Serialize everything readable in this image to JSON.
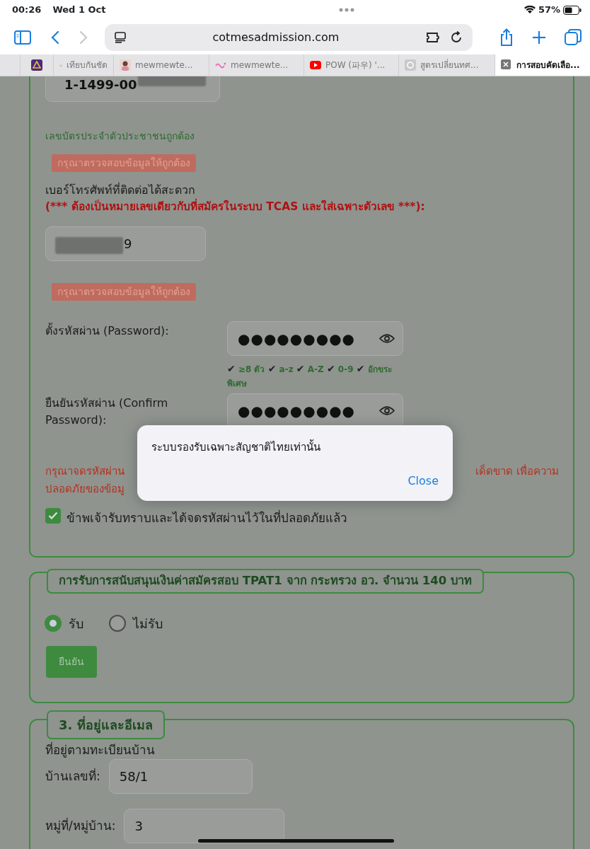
{
  "status_bar": {
    "time": "00:26",
    "date": "Wed 1 Oct",
    "battery": "57%"
  },
  "browser": {
    "url": "cotmesadmission.com",
    "forward_disabled": true,
    "tabs": [
      {
        "selected": false
      },
      {
        "label": "เทียบกันชัด",
        "selected": false
      },
      {
        "label": "mewmewte...",
        "selected": false
      },
      {
        "label": "mewmewte...",
        "selected": false
      },
      {
        "label": "POW (파우) '...",
        "selected": false
      },
      {
        "label": "สูตรเปลี่ยนทศ...",
        "selected": false
      },
      {
        "label": "การสอบคัดเลือ...",
        "selected": true
      }
    ]
  },
  "form": {
    "id_field": {
      "value": "1-1499-00"
    },
    "id_valid_message": "เลขบัตรประจำตัวประชาชนถูกต้อง",
    "id_error": "กรุณาตรวจสอบข้อมูลให้ถูกต้อง",
    "phone_label": "เบอร์โทรศัพท์ที่ติดต่อได้สะดวก",
    "phone_note": "(*** ต้องเป็นหมายเลขเดียวกับที่สมัครในระบบ TCAS และใส่เฉพาะตัวเลข ***):",
    "phone_field": {
      "value": "9"
    },
    "phone_error": "กรุณาตรวจสอบข้อมูลให้ถูกต้อง",
    "password_label": "ตั้งรหัสผ่าน (Password):",
    "password_value": "●●●●●●●●●",
    "password_checks": [
      {
        "mark": "✔",
        "label": "≥8 ตัว"
      },
      {
        "mark": "✔",
        "label": "a-z"
      },
      {
        "mark": "✔",
        "label": "A-Z"
      },
      {
        "mark": "✔",
        "label": "0-9"
      },
      {
        "mark": "✔",
        "label": "อักขระพิเศษ"
      }
    ],
    "confirm_label": "ยืนยันรหัสผ่าน (Confirm Password):",
    "confirm_value": "●●●●●●●●●",
    "warning_fragments": [
      "กรุณาจดรหัสผ่าน",
      "เด็ดขาด เพื่อความ",
      "ปลอดภัยของข้อมู"
    ],
    "acknowledge": {
      "label": "ข้าพเจ้ารับทราบและได้จดรหัสผ่านไว้ในที่ปลอดภัยแล้ว",
      "checked": true
    }
  },
  "support_section": {
    "legend": "การรับการสนับสนุนเงินค่าสมัครสอบ TPAT1 จาก กระทรวง อว. จำนวน 140 บาท",
    "options": [
      {
        "label": "รับ",
        "selected": true
      },
      {
        "label": "ไม่รับ",
        "selected": false
      }
    ],
    "button": "ยืนยัน"
  },
  "address_section": {
    "legend": "3. ที่อยู่และอีเมล",
    "subheading": "ที่อยู่ตามทะเบียนบ้าน",
    "fields": [
      {
        "label": "บ้านเลขที่:",
        "value": "58/1"
      },
      {
        "label": "หมู่ที่/หมู่บ้าน:",
        "value": "3"
      }
    ]
  },
  "alert": {
    "message": "ระบบรองรับเฉพาะสัญชาติไทยเท่านั้น",
    "button": "Close"
  }
}
